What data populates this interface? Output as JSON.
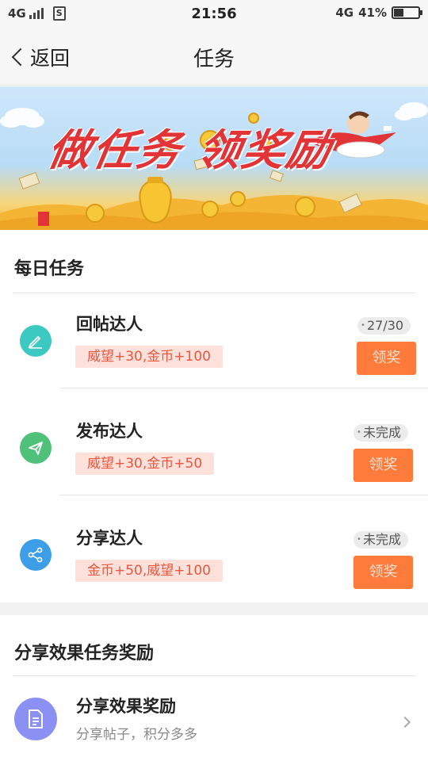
{
  "status_bar": {
    "network_left": "4G",
    "sim_glyph": "S",
    "time": "21:56",
    "network_right": "4G",
    "battery_percent": "41%",
    "battery_level": 0.41
  },
  "nav": {
    "back_label": "返回",
    "title": "任务"
  },
  "banner": {
    "text": "做任务 领奖励",
    "bg_color": "#cfe7fb",
    "accent_color": "#e23336"
  },
  "daily": {
    "title": "每日任务",
    "tasks": [
      {
        "name": "回帖达人",
        "reward": "威望+30,金币+100",
        "progress": "27/30",
        "button": "领奖",
        "icon": "pencil-icon",
        "icon_color": "#3cc9c2"
      },
      {
        "name": "发布达人",
        "reward": "威望+30,金币+50",
        "progress": "未完成",
        "button": "领奖",
        "icon": "paper-plane-icon",
        "icon_color": "#4fc178"
      },
      {
        "name": "分享达人",
        "reward": "金币+50,威望+100",
        "progress": "未完成",
        "button": "领奖",
        "icon": "share-icon",
        "icon_color": "#3b9ee6"
      }
    ]
  },
  "share_reward": {
    "title": "分享效果任务奖励",
    "item": {
      "name": "分享效果奖励",
      "subtitle": "分享帖子，积分多多",
      "icon": "document-icon",
      "icon_color": "#8b91f2"
    }
  },
  "colors": {
    "claim_button": "#ff7b3b",
    "reward_tag_bg": "#fde1da",
    "reward_tag_text": "#e9573f"
  }
}
